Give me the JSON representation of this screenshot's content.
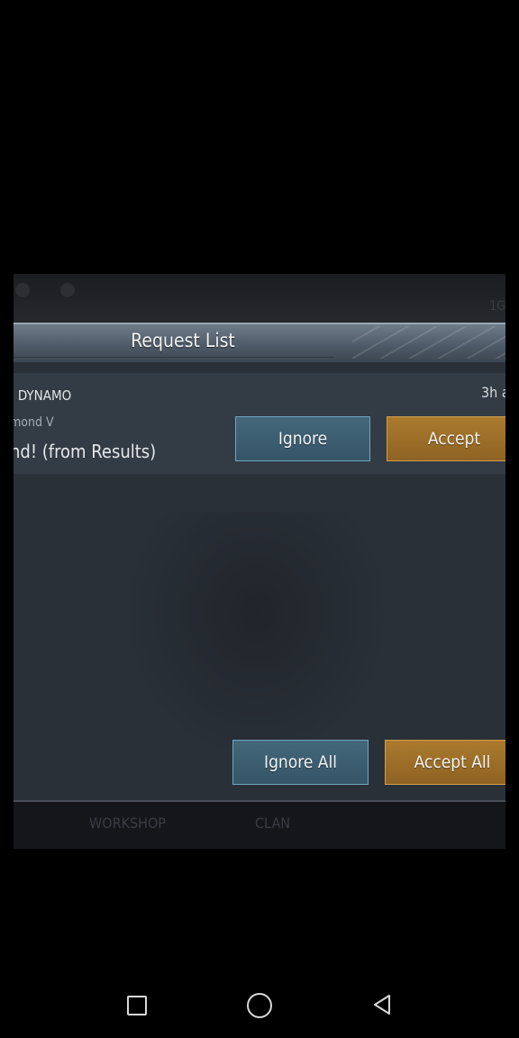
{
  "dialog": {
    "title": "Request List",
    "request": {
      "player_name": "| DYNAMO",
      "rank": "mond V",
      "message": "nd! (from Results)",
      "time": "3h a",
      "ignore_label": "Ignore",
      "accept_label": "Accept"
    },
    "ignore_all_label": "Ignore All",
    "accept_all_label": "Accept All"
  },
  "bottom_nav": {
    "workshop": "WORKSHOP",
    "clan": "CLAN"
  },
  "top_bar": {
    "partial_text": "1G"
  },
  "colors": {
    "accept": "#9c6e28",
    "ignore": "#3f6274",
    "header": "#5c6875"
  },
  "system_nav": {
    "icons": [
      "recent-apps-icon",
      "home-icon",
      "back-icon"
    ]
  }
}
